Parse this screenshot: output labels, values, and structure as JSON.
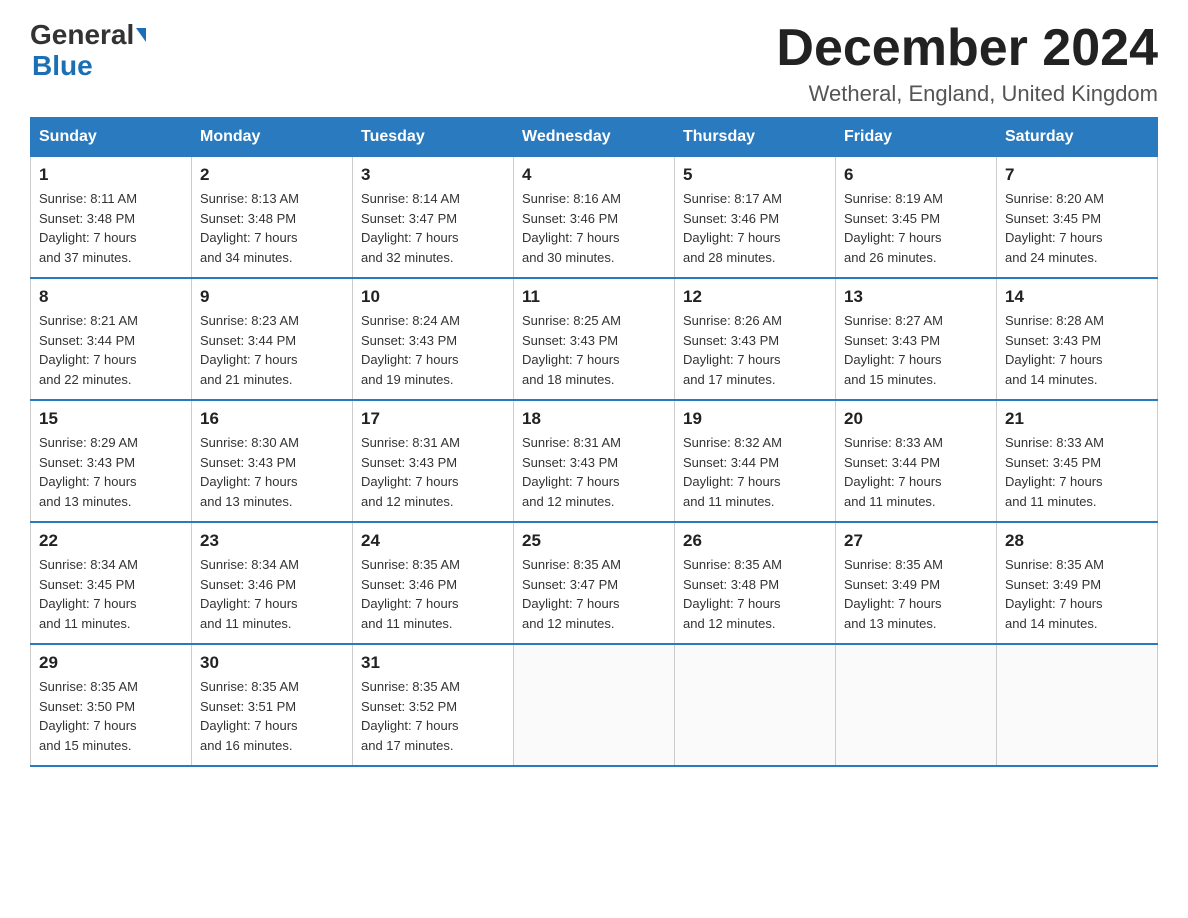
{
  "logo": {
    "text_general": "General",
    "text_blue": "Blue"
  },
  "header": {
    "title": "December 2024",
    "subtitle": "Wetheral, England, United Kingdom"
  },
  "days_of_week": [
    "Sunday",
    "Monday",
    "Tuesday",
    "Wednesday",
    "Thursday",
    "Friday",
    "Saturday"
  ],
  "weeks": [
    [
      {
        "day": "1",
        "sunrise": "8:11 AM",
        "sunset": "3:48 PM",
        "daylight": "7 hours and 37 minutes."
      },
      {
        "day": "2",
        "sunrise": "8:13 AM",
        "sunset": "3:48 PM",
        "daylight": "7 hours and 34 minutes."
      },
      {
        "day": "3",
        "sunrise": "8:14 AM",
        "sunset": "3:47 PM",
        "daylight": "7 hours and 32 minutes."
      },
      {
        "day": "4",
        "sunrise": "8:16 AM",
        "sunset": "3:46 PM",
        "daylight": "7 hours and 30 minutes."
      },
      {
        "day": "5",
        "sunrise": "8:17 AM",
        "sunset": "3:46 PM",
        "daylight": "7 hours and 28 minutes."
      },
      {
        "day": "6",
        "sunrise": "8:19 AM",
        "sunset": "3:45 PM",
        "daylight": "7 hours and 26 minutes."
      },
      {
        "day": "7",
        "sunrise": "8:20 AM",
        "sunset": "3:45 PM",
        "daylight": "7 hours and 24 minutes."
      }
    ],
    [
      {
        "day": "8",
        "sunrise": "8:21 AM",
        "sunset": "3:44 PM",
        "daylight": "7 hours and 22 minutes."
      },
      {
        "day": "9",
        "sunrise": "8:23 AM",
        "sunset": "3:44 PM",
        "daylight": "7 hours and 21 minutes."
      },
      {
        "day": "10",
        "sunrise": "8:24 AM",
        "sunset": "3:43 PM",
        "daylight": "7 hours and 19 minutes."
      },
      {
        "day": "11",
        "sunrise": "8:25 AM",
        "sunset": "3:43 PM",
        "daylight": "7 hours and 18 minutes."
      },
      {
        "day": "12",
        "sunrise": "8:26 AM",
        "sunset": "3:43 PM",
        "daylight": "7 hours and 17 minutes."
      },
      {
        "day": "13",
        "sunrise": "8:27 AM",
        "sunset": "3:43 PM",
        "daylight": "7 hours and 15 minutes."
      },
      {
        "day": "14",
        "sunrise": "8:28 AM",
        "sunset": "3:43 PM",
        "daylight": "7 hours and 14 minutes."
      }
    ],
    [
      {
        "day": "15",
        "sunrise": "8:29 AM",
        "sunset": "3:43 PM",
        "daylight": "7 hours and 13 minutes."
      },
      {
        "day": "16",
        "sunrise": "8:30 AM",
        "sunset": "3:43 PM",
        "daylight": "7 hours and 13 minutes."
      },
      {
        "day": "17",
        "sunrise": "8:31 AM",
        "sunset": "3:43 PM",
        "daylight": "7 hours and 12 minutes."
      },
      {
        "day": "18",
        "sunrise": "8:31 AM",
        "sunset": "3:43 PM",
        "daylight": "7 hours and 12 minutes."
      },
      {
        "day": "19",
        "sunrise": "8:32 AM",
        "sunset": "3:44 PM",
        "daylight": "7 hours and 11 minutes."
      },
      {
        "day": "20",
        "sunrise": "8:33 AM",
        "sunset": "3:44 PM",
        "daylight": "7 hours and 11 minutes."
      },
      {
        "day": "21",
        "sunrise": "8:33 AM",
        "sunset": "3:45 PM",
        "daylight": "7 hours and 11 minutes."
      }
    ],
    [
      {
        "day": "22",
        "sunrise": "8:34 AM",
        "sunset": "3:45 PM",
        "daylight": "7 hours and 11 minutes."
      },
      {
        "day": "23",
        "sunrise": "8:34 AM",
        "sunset": "3:46 PM",
        "daylight": "7 hours and 11 minutes."
      },
      {
        "day": "24",
        "sunrise": "8:35 AM",
        "sunset": "3:46 PM",
        "daylight": "7 hours and 11 minutes."
      },
      {
        "day": "25",
        "sunrise": "8:35 AM",
        "sunset": "3:47 PM",
        "daylight": "7 hours and 12 minutes."
      },
      {
        "day": "26",
        "sunrise": "8:35 AM",
        "sunset": "3:48 PM",
        "daylight": "7 hours and 12 minutes."
      },
      {
        "day": "27",
        "sunrise": "8:35 AM",
        "sunset": "3:49 PM",
        "daylight": "7 hours and 13 minutes."
      },
      {
        "day": "28",
        "sunrise": "8:35 AM",
        "sunset": "3:49 PM",
        "daylight": "7 hours and 14 minutes."
      }
    ],
    [
      {
        "day": "29",
        "sunrise": "8:35 AM",
        "sunset": "3:50 PM",
        "daylight": "7 hours and 15 minutes."
      },
      {
        "day": "30",
        "sunrise": "8:35 AM",
        "sunset": "3:51 PM",
        "daylight": "7 hours and 16 minutes."
      },
      {
        "day": "31",
        "sunrise": "8:35 AM",
        "sunset": "3:52 PM",
        "daylight": "7 hours and 17 minutes."
      },
      null,
      null,
      null,
      null
    ]
  ],
  "labels": {
    "sunrise": "Sunrise:",
    "sunset": "Sunset:",
    "daylight": "Daylight:"
  }
}
